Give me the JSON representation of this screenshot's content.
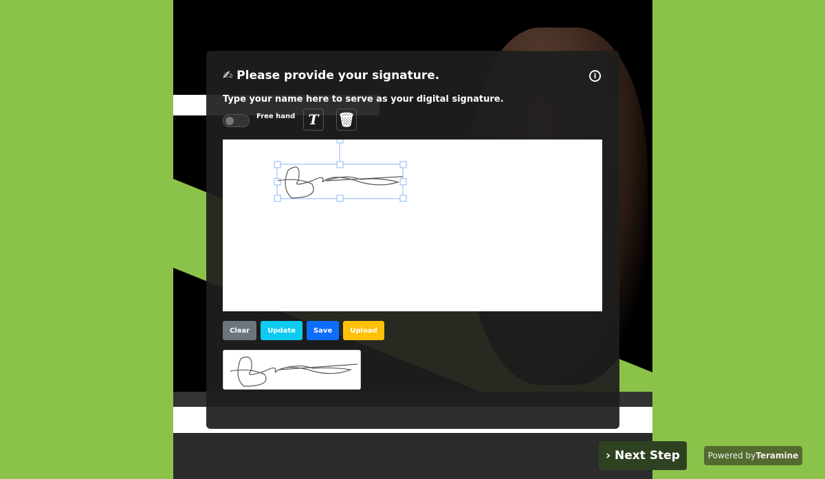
{
  "modal": {
    "title": "Please provide your signature.",
    "subtitle": "Type your name here to serve as your digital signature.",
    "freehand_label": "Free hand",
    "text_tool": "T",
    "freehand_on": false
  },
  "buttons": {
    "clear": "Clear",
    "update": "Update",
    "save": "Save",
    "upload": "Upload"
  },
  "colors": {
    "clear": "#6c757d",
    "update": "#0dcaf0",
    "save": "#0d6efd",
    "upload": "#ffc107"
  },
  "footer": {
    "next": "Next Step",
    "powered_prefix": "Powered by",
    "powered_brand": "Teramine"
  }
}
